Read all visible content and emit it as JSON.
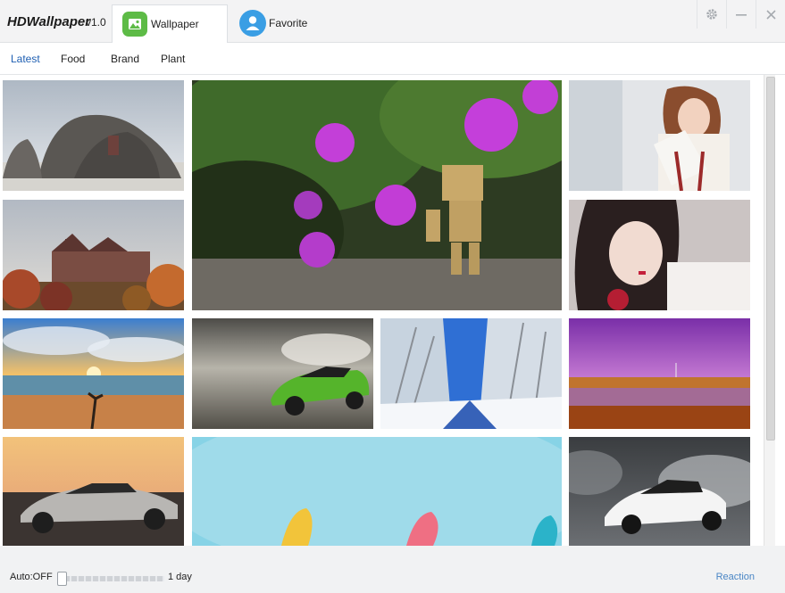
{
  "app": {
    "name": "HDWallpaper",
    "version": "v1.0"
  },
  "tabs": [
    {
      "label": "Wallpaper",
      "icon": "image-icon",
      "color": "#5dbb46"
    },
    {
      "label": "Favorite",
      "icon": "user-icon",
      "color": "#3a9ee4"
    }
  ],
  "window_buttons": [
    "gear-icon",
    "minimize-icon",
    "close-icon"
  ],
  "categories": [
    {
      "label": "Latest",
      "active": true
    },
    {
      "label": "Food"
    },
    {
      "label": "Brand"
    },
    {
      "label": "Plant"
    }
  ],
  "wallpapers": [
    {
      "subject": "rock-coast"
    },
    {
      "subject": "flower-figure"
    },
    {
      "subject": "girl-white"
    },
    {
      "subject": "castle"
    },
    {
      "subject": "girl-red"
    },
    {
      "subject": "sunset-beach"
    },
    {
      "subject": "green-car"
    },
    {
      "subject": "snow-trees"
    },
    {
      "subject": "purple-lake"
    },
    {
      "subject": "silver-car"
    },
    {
      "subject": "cyan-sky"
    },
    {
      "subject": "white-car"
    }
  ],
  "footer": {
    "auto_label": "Auto:OFF",
    "interval_label": "1 day",
    "reaction_label": "Reaction"
  },
  "slider": {
    "value": 0
  },
  "colors": {
    "active_category": "#1f5fb2",
    "link": "#4a86c5"
  }
}
